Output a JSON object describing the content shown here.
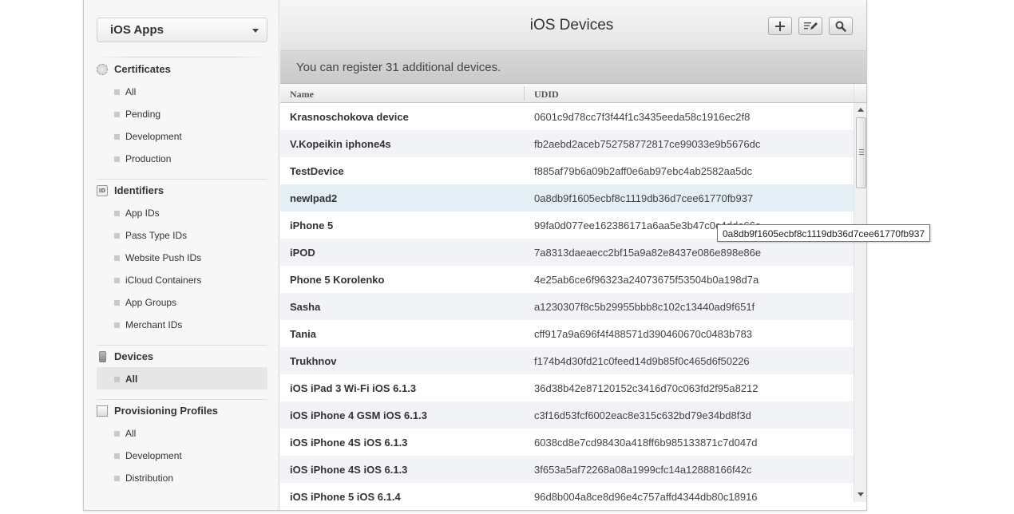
{
  "sidebar": {
    "app_selector": "iOS Apps",
    "sections": [
      {
        "title": "Certificates",
        "icon": "certificate-icon",
        "items": [
          "All",
          "Pending",
          "Development",
          "Production"
        ]
      },
      {
        "title": "Identifiers",
        "icon": "id-icon",
        "items": [
          "App IDs",
          "Pass Type IDs",
          "Website Push IDs",
          "iCloud Containers",
          "App Groups",
          "Merchant IDs"
        ]
      },
      {
        "title": "Devices",
        "icon": "device-icon",
        "items": [
          "All"
        ],
        "active_item": "All"
      },
      {
        "title": "Provisioning Profiles",
        "icon": "profile-icon",
        "items": [
          "All",
          "Development",
          "Distribution"
        ]
      }
    ]
  },
  "header": {
    "title": "iOS Devices",
    "buttons": [
      "add-icon",
      "edit-icon",
      "search-icon"
    ]
  },
  "banner": {
    "text": "You can register 31 additional devices."
  },
  "table": {
    "columns": [
      "Name",
      "UDID"
    ],
    "rows": [
      {
        "name": "Krasnoschokova device",
        "udid": "0601c9d78cc7f3f44f1c3435eeda58c1916ec2f8"
      },
      {
        "name": "V.Kopeikin iphone4s",
        "udid": "fb2aebd2aceb752758772817ce99033e9b5676dc"
      },
      {
        "name": "TestDevice",
        "udid": "f885af79b6a09b2aff0e6ab97ebc4ab2582aa5dc"
      },
      {
        "name": "newIpad2",
        "udid": "0a8db9f1605ecbf8c1119db36d7cee61770fb937"
      },
      {
        "name": "iPhone 5",
        "udid": "99fa0d077ee162386171a6aa5e3b47c0c4dde66e"
      },
      {
        "name": "iPOD",
        "udid": "7a8313daeaecc2bf15a9a82e8437e086e898e86e"
      },
      {
        "name": "Phone 5 Korolenko",
        "udid": "4e25ab6ce6f96323a24073675f53504b0a198d7a"
      },
      {
        "name": "Sasha",
        "udid": "a1230307f8c5b29955bbb8c102c13440ad9f651f"
      },
      {
        "name": "Tania",
        "udid": "cff917a9a696f4f488571d390460670c0483b783"
      },
      {
        "name": "Trukhnov",
        "udid": "f174b4d30fd21c0feed14d9b85f0c465d6f50226"
      },
      {
        "name": "iOS iPad 3 Wi-Fi iOS 6.1.3",
        "udid": "36d38b42e87120152c3416d70c063fd2f95a8212"
      },
      {
        "name": "iOS iPhone 4 GSM iOS 6.1.3",
        "udid": "c3f16d53fcf6002eac8e315c632bd79e34bd8f3d"
      },
      {
        "name": "iOS iPhone 4S iOS 6.1.3",
        "udid": "6038cd8e7cd98430a418ff6b985133871c7d047d"
      },
      {
        "name": "iOS iPhone 4S iOS 6.1.3",
        "udid": "3f653a5af72268a08a1999cfc14a12888166f42c"
      },
      {
        "name": "iOS iPhone 5 iOS 6.1.4",
        "udid": "96d8b004a8ce8d96e4c757affd4344db80c18916"
      }
    ],
    "highlighted_row": 3
  },
  "tooltip": {
    "text": "0a8db9f1605ecbf8c1119db36d7cee61770fb937"
  }
}
